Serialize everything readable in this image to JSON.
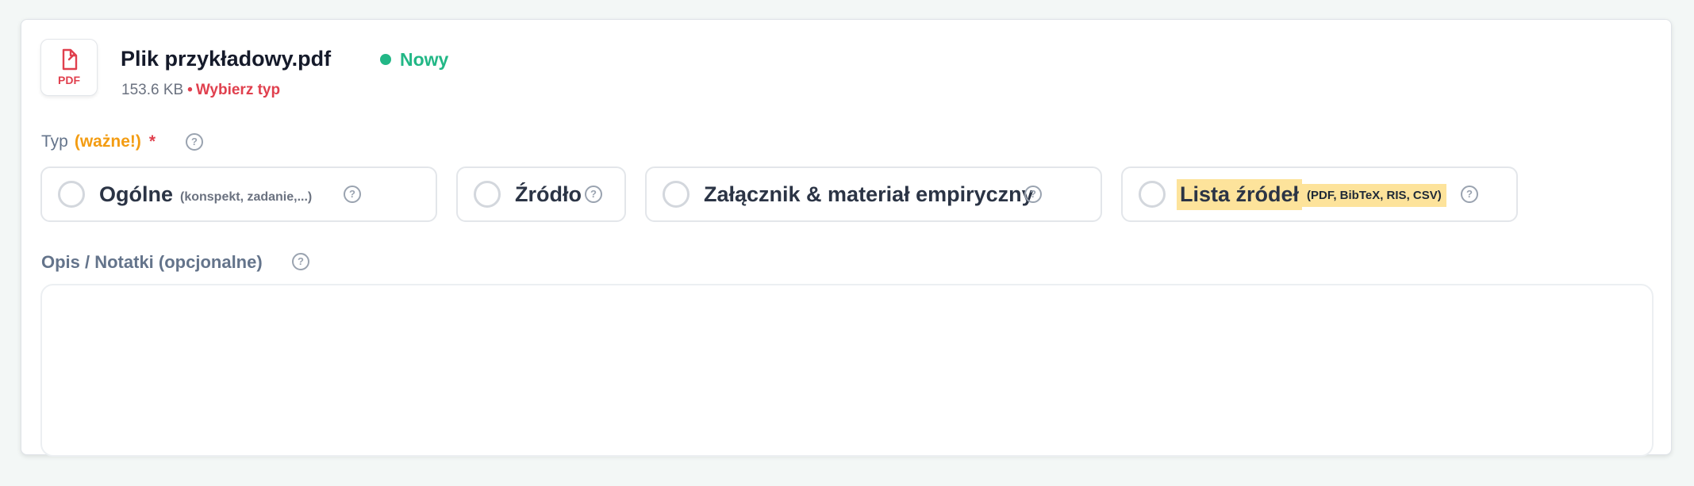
{
  "file": {
    "icon": "pdf-file-icon",
    "type_label": "PDF",
    "name": "Plik przykładowy.pdf",
    "status": "Nowy",
    "size": "153.6 KB",
    "separator": "•",
    "action": "Wybierz typ"
  },
  "type_field": {
    "label": "Typ",
    "important": "(ważne!)",
    "required_marker": "*",
    "help": "?"
  },
  "type_options": [
    {
      "label": "Ogólne",
      "hint": "(konspekt, zadanie,...)",
      "help": "?",
      "selected": false
    },
    {
      "label": "Źródło",
      "hint": "",
      "help": "?",
      "selected": false
    },
    {
      "label": "Załącznik & materiał empiryczny",
      "hint": "",
      "help": "?",
      "selected": false
    },
    {
      "label": "Lista źródeł",
      "hint": "(PDF, BibTeX, RIS, CSV)",
      "help": "?",
      "selected": false,
      "highlighted": true
    }
  ],
  "notes_field": {
    "label": "Opis / Notatki (opcjonalne)",
    "help": "?",
    "value": "",
    "placeholder": ""
  },
  "colors": {
    "status_green": "#22b786",
    "accent_red": "#e0404e",
    "important_orange": "#f39c12",
    "highlight_yellow": "#fde39b"
  }
}
